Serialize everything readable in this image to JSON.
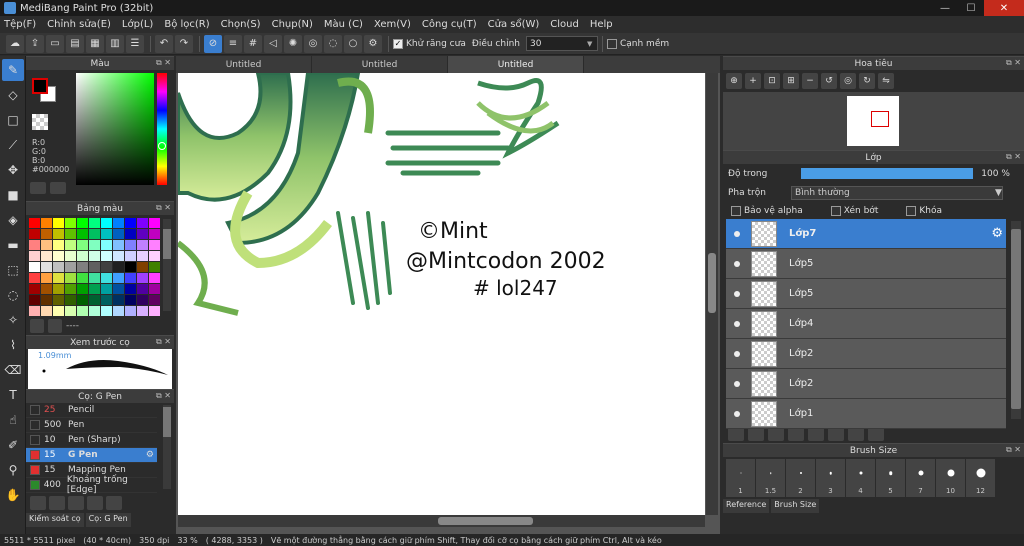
{
  "window": {
    "title": "MediBang Paint Pro (32bit)",
    "min": "—",
    "max": "☐",
    "close": "✕"
  },
  "menu": [
    "Tệp(F)",
    "Chỉnh sửa(E)",
    "Lớp(L)",
    "Bộ lọc(R)",
    "Chọn(S)",
    "Chụp(N)",
    "Màu (C)",
    "Xem(V)",
    "Công cụ(T)",
    "Cửa sổ(W)",
    "Cloud",
    "Help"
  ],
  "toolbar": {
    "antialias_label": "Khử răng cưa",
    "correction_label": "Điều chỉnh",
    "correction_value": "30",
    "snap_label": "Cạnh mềm"
  },
  "panels": {
    "color": {
      "title": "Màu",
      "r": "R:0",
      "g": "G:0",
      "b": "B:0",
      "hex": "#000000"
    },
    "palette": {
      "title": "Bảng màu",
      "footer": "----"
    },
    "brush_preview": {
      "title": "Xem trước cọ",
      "size": "1.09mm"
    },
    "brush": {
      "title": "Cọ: G Pen"
    },
    "left_tabs": [
      "Kiểm soát cọ",
      "Cọ: G Pen"
    ],
    "navigator": {
      "title": "Hoa tiêu"
    },
    "layer": {
      "title": "Lớp",
      "opacity_label": "Độ trong",
      "opacity_value": "100 %",
      "blend_label": "Pha trộn",
      "blend_value": "Bình thường",
      "protect_alpha": "Bảo vệ alpha",
      "clip": "Xén bớt",
      "lock": "Khóa"
    },
    "brush_size": {
      "title": "Brush Size"
    },
    "right_tabs": [
      "Reference",
      "Brush Size"
    ]
  },
  "brushes": [
    {
      "size": "25",
      "name": "Pencil",
      "color": "#2b2b2b",
      "size_color": "#e05050"
    },
    {
      "size": "500",
      "name": "Pen",
      "color": "#2b2b2b",
      "size_color": "#dddddd"
    },
    {
      "size": "10",
      "name": "Pen (Sharp)",
      "color": "#2b2b2b",
      "size_color": "#dddddd"
    },
    {
      "size": "15",
      "name": "G Pen",
      "color": "#e03030",
      "size_color": "#ffffff",
      "selected": true
    },
    {
      "size": "15",
      "name": "Mapping Pen",
      "color": "#e03030",
      "size_color": "#dddddd"
    },
    {
      "size": "400",
      "name": "Khoảng trống [Edge]",
      "color": "#2b8a2b",
      "size_color": "#dddddd"
    }
  ],
  "tabs": [
    "Untitled",
    "Untitled",
    "Untitled"
  ],
  "layers": [
    {
      "name": "Lớp7",
      "selected": true
    },
    {
      "name": "Lớp5"
    },
    {
      "name": "Lớp5"
    },
    {
      "name": "Lớp4"
    },
    {
      "name": "Lớp2"
    },
    {
      "name": "Lớp2"
    },
    {
      "name": "Lớp1"
    }
  ],
  "brush_sizes": [
    {
      "label": "1",
      "d": 1
    },
    {
      "label": "1.5",
      "d": 1.5
    },
    {
      "label": "2",
      "d": 2
    },
    {
      "label": "3",
      "d": 2.5
    },
    {
      "label": "4",
      "d": 3
    },
    {
      "label": "5",
      "d": 3.5
    },
    {
      "label": "7",
      "d": 5
    },
    {
      "label": "10",
      "d": 7
    },
    {
      "label": "12",
      "d": 9
    }
  ],
  "canvas_text": {
    "line1": "©Mint",
    "line2": "@Mintcodon 2002",
    "line3": "# lol247"
  },
  "status": {
    "dims": "5511 * 5511 pixel",
    "size": "(40 * 40cm)",
    "dpi": "350 dpi",
    "zoom": "33 %",
    "coords": "( 4288, 3353 )",
    "hint": "Vẽ một đường thẳng bằng cách giữ phím Shift, Thay đổi cỡ cọ bằng cách giữ phím Ctrl, Alt và kéo"
  }
}
